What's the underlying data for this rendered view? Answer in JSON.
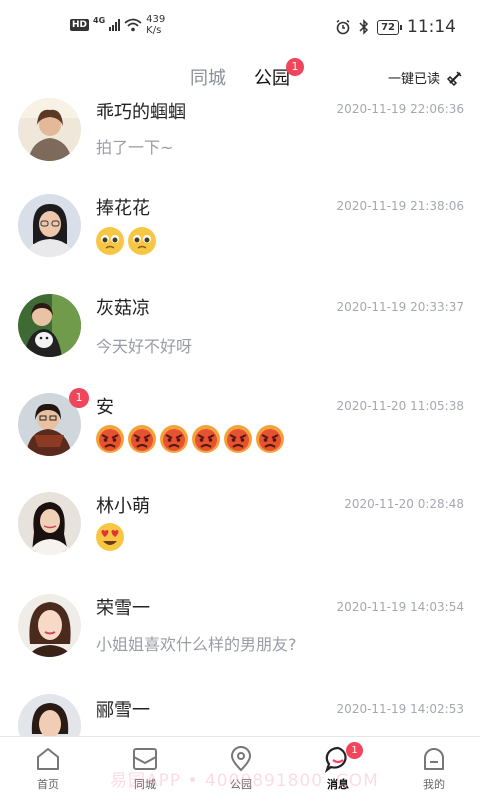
{
  "status_bar": {
    "hd": "HD",
    "network": "4G",
    "speed_value": "439",
    "speed_unit": "K/s",
    "battery": "72",
    "time": "11:14",
    "icons": [
      "alarm-icon",
      "bluetooth-icon",
      "wifi-icon",
      "signal-icon",
      "battery-icon"
    ]
  },
  "header": {
    "tabs": [
      {
        "label": "同城",
        "active": false
      },
      {
        "label": "公园",
        "active": true,
        "badge": "1"
      }
    ],
    "mark_read_label": "一键已读",
    "mark_read_icon": "broom-icon"
  },
  "messages": [
    {
      "name": "乖巧的蝈蝈",
      "time": "2020-11-19 22:06:36",
      "preview": "拍了一下~",
      "emoji": null,
      "badge": null
    },
    {
      "name": "捧花花",
      "time": "2020-11-19 21:38:06",
      "preview": null,
      "emoji": {
        "type": "pleading-face",
        "count": 2
      },
      "badge": null
    },
    {
      "name": "灰菇凉",
      "time": "2020-11-19 20:33:37",
      "preview": "今天好不好呀",
      "emoji": null,
      "badge": null
    },
    {
      "name": "安",
      "time": "2020-11-20 11:05:38",
      "preview": null,
      "emoji": {
        "type": "angry-face",
        "count": 6
      },
      "badge": "1"
    },
    {
      "name": "林小萌",
      "time": "2020-11-20 0:28:48",
      "preview": null,
      "emoji": {
        "type": "heart-eyes-face",
        "count": 1
      },
      "badge": null
    },
    {
      "name": "荣雪一",
      "time": "2020-11-19 14:03:54",
      "preview": "小姐姐喜欢什么样的男朋友?",
      "emoji": null,
      "badge": null
    },
    {
      "name": "郦雪一",
      "time": "2020-11-19 14:02:53",
      "preview": null,
      "emoji": null,
      "badge": null
    }
  ],
  "bottom_nav": [
    {
      "label": "首页",
      "icon": "home-icon"
    },
    {
      "label": "同城",
      "icon": "mail-icon"
    },
    {
      "label": "公园",
      "icon": "location-icon"
    },
    {
      "label": "消息",
      "icon": "chat-icon",
      "active": true,
      "badge": "1"
    },
    {
      "label": "我的",
      "icon": "profile-icon"
    }
  ],
  "watermark": "易园APP • 4000891800 .COM",
  "colors": {
    "badge": "#f0455b",
    "muted_text": "#9a9da6",
    "timestamp": "#a5a8b0"
  }
}
